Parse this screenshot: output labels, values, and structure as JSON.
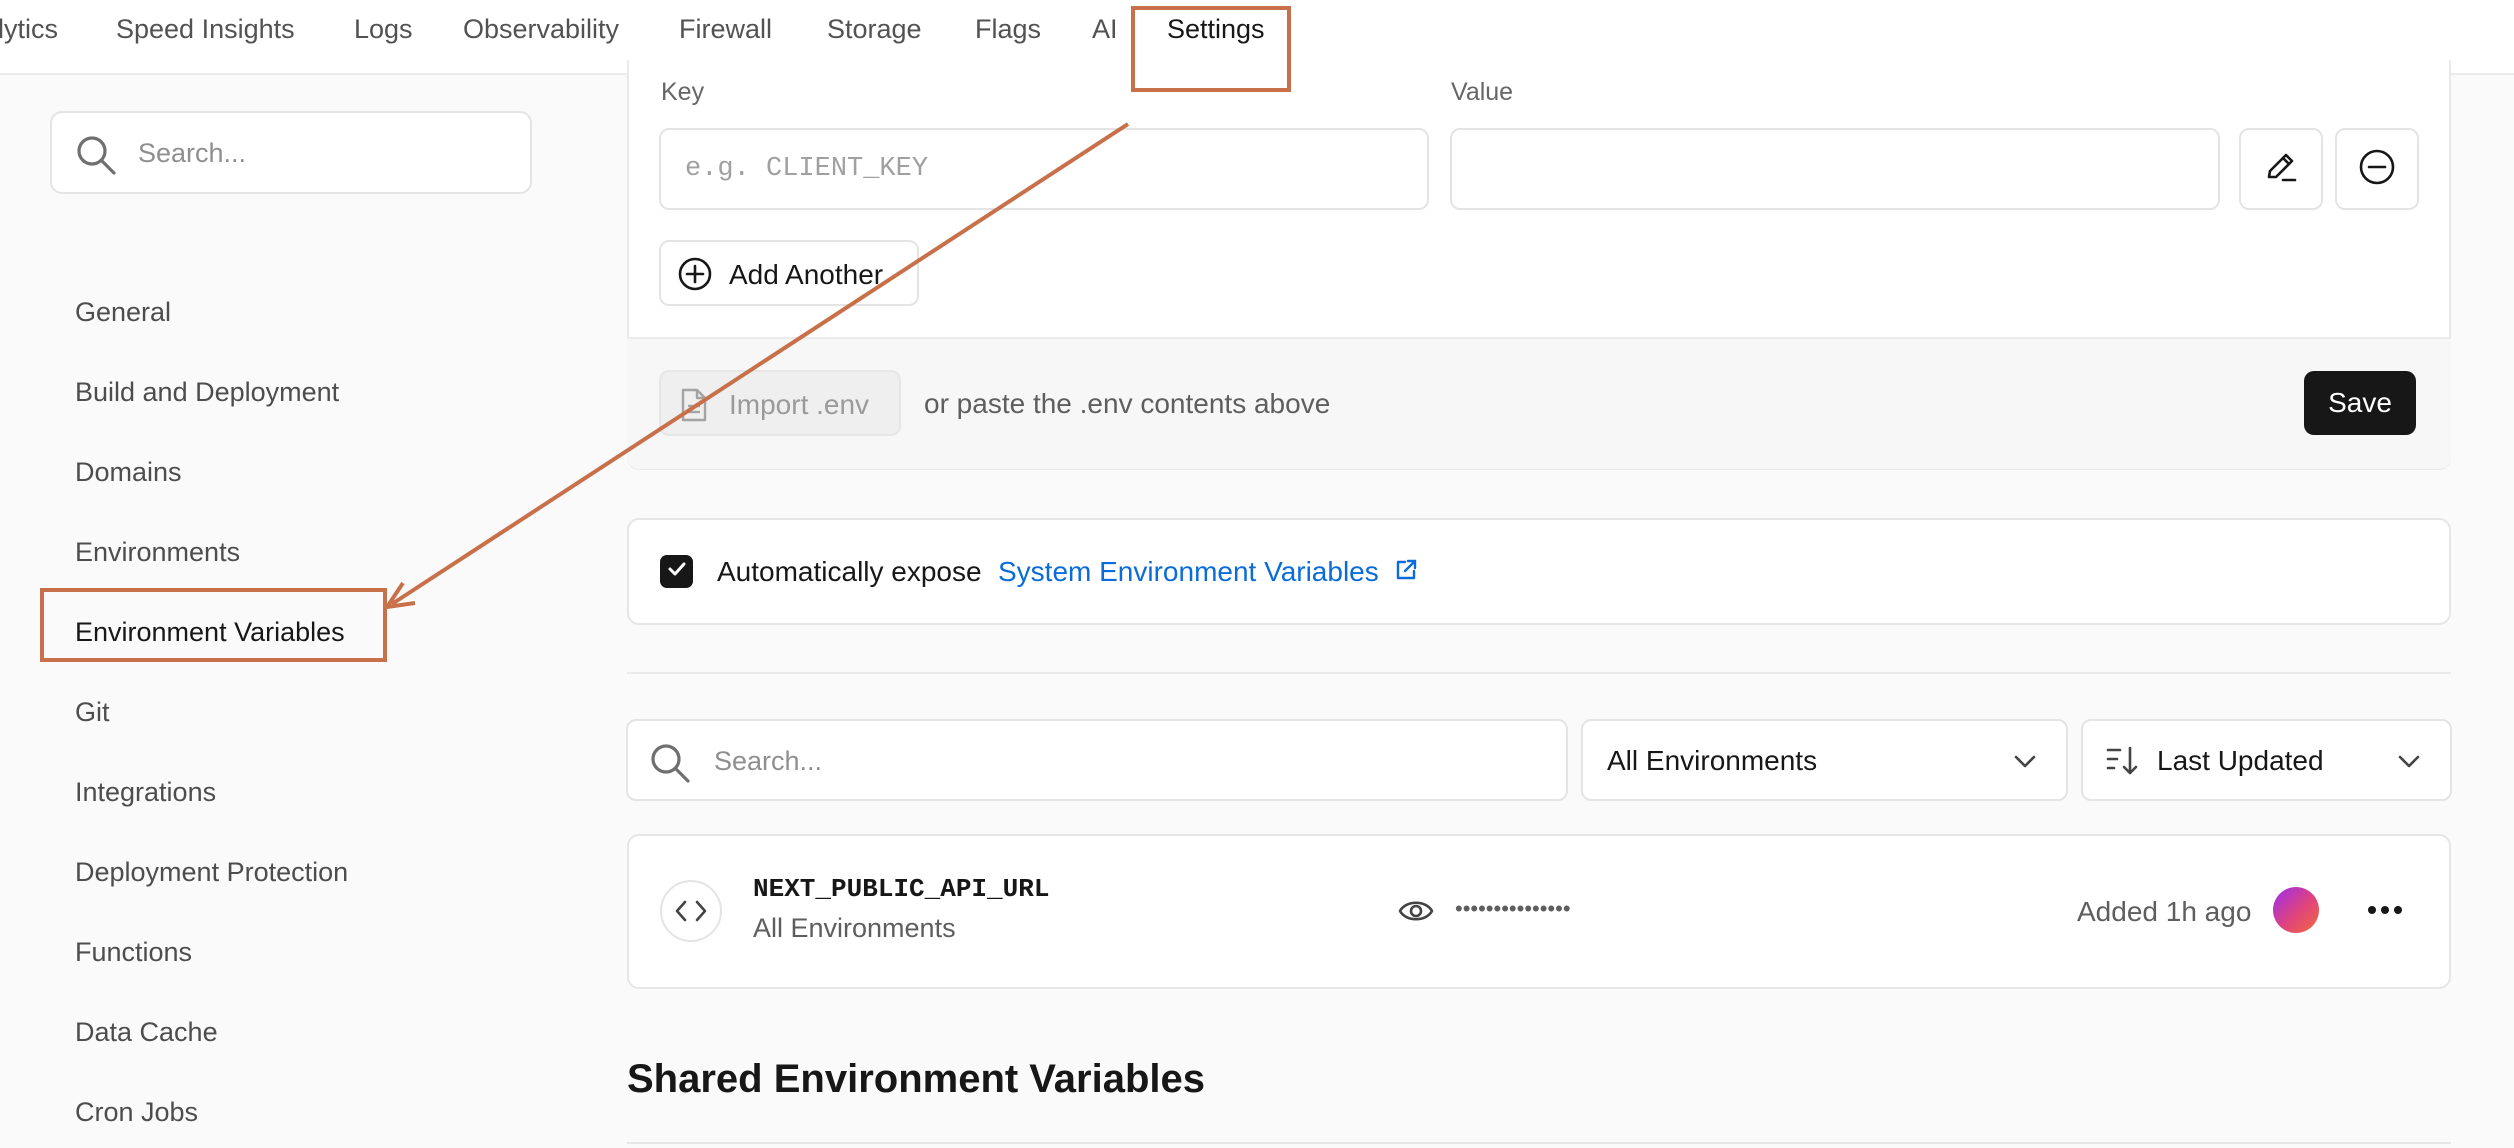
{
  "nav": {
    "tabs": [
      {
        "label": "lytics"
      },
      {
        "label": "Speed Insights"
      },
      {
        "label": "Logs"
      },
      {
        "label": "Observability"
      },
      {
        "label": "Firewall"
      },
      {
        "label": "Storage"
      },
      {
        "label": "Flags"
      },
      {
        "label": "AI"
      },
      {
        "label": "Settings",
        "active": true
      }
    ]
  },
  "sidebar": {
    "search_placeholder": "Search...",
    "items": [
      {
        "label": "General"
      },
      {
        "label": "Build and Deployment"
      },
      {
        "label": "Domains"
      },
      {
        "label": "Environments"
      },
      {
        "label": "Environment Variables",
        "active": true
      },
      {
        "label": "Git"
      },
      {
        "label": "Integrations"
      },
      {
        "label": "Deployment Protection"
      },
      {
        "label": "Functions"
      },
      {
        "label": "Data Cache"
      },
      {
        "label": "Cron Jobs"
      }
    ]
  },
  "form": {
    "key_label": "Key",
    "value_label": "Value",
    "key_placeholder": "e.g. CLIENT_KEY",
    "key_value": "",
    "value_value": "",
    "add_another_label": "Add Another",
    "import_label": "Import .env",
    "paste_hint": "or paste the .env contents above",
    "save_label": "Save"
  },
  "expose": {
    "checked": true,
    "text": "Automatically expose",
    "link_text": "System Environment Variables"
  },
  "filters": {
    "search_placeholder": "Search...",
    "environment_select": "All Environments",
    "sort_select": "Last Updated"
  },
  "variables": [
    {
      "name": "NEXT_PUBLIC_API_URL",
      "environments": "All Environments",
      "masked_value": "•••••••••••••••",
      "added": "Added 1h ago"
    }
  ],
  "shared_section_title": "Shared Environment Variables",
  "colors": {
    "accent_link": "#0a6cdb",
    "primary_button": "#171717",
    "annotation": "#c8704a"
  },
  "icons": {
    "search": "search-icon",
    "edit": "pencil-icon",
    "remove": "minus-circle-icon",
    "add": "plus-circle-icon",
    "file": "file-icon",
    "checkbox": "check-icon",
    "external": "external-link-icon",
    "chevron": "chevron-down-icon",
    "sort": "sort-icon",
    "code": "code-icon",
    "eye": "eye-icon",
    "more": "more-horizontal-icon"
  }
}
